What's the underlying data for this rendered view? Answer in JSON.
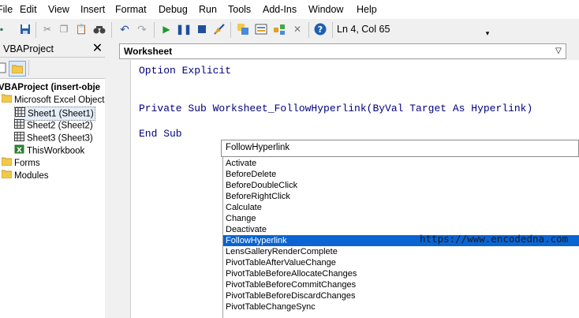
{
  "menu": [
    "File",
    "Edit",
    "View",
    "Insert",
    "Format",
    "Debug",
    "Run",
    "Tools",
    "Add-Ins",
    "Window",
    "Help"
  ],
  "status": {
    "position": "Ln 4, Col 65"
  },
  "toolbar_icons": [
    "excel-icon",
    "save-icon",
    "cut-icon",
    "copy-icon",
    "paste-icon",
    "find-icon",
    "undo-icon",
    "redo-icon",
    "run-icon",
    "break-icon",
    "reset-icon",
    "design-mode-icon",
    "project-explorer-icon",
    "properties-icon",
    "object-browser-icon",
    "toolbox-icon",
    "help-icon"
  ],
  "project": {
    "title": "VBAProject",
    "close_glyph": "✕",
    "root": "VBAProject (insert-obje",
    "excel_objects": "Microsoft Excel Objects",
    "sheets": [
      "Sheet1 (Sheet1)",
      "Sheet2 (Sheet2)",
      "Sheet3 (Sheet3)"
    ],
    "workbook": "ThisWorkbook",
    "forms": "Forms",
    "modules": "Modules"
  },
  "editor": {
    "object_combo": "Worksheet",
    "lines": [
      "Option Explicit",
      "Private Sub Worksheet_FollowHyperlink(ByVal Target As Hyperlink)",
      "End Sub"
    ]
  },
  "autocomplete": {
    "input": "FollowHyperlink",
    "items": [
      "Activate",
      "BeforeDelete",
      "BeforeDoubleClick",
      "BeforeRightClick",
      "Calculate",
      "Change",
      "Deactivate",
      "FollowHyperlink",
      "LensGalleryRenderComplete",
      "PivotTableAfterValueChange",
      "PivotTableBeforeAllocateChanges",
      "PivotTableBeforeCommitChanges",
      "PivotTableBeforeDiscardChanges",
      "PivotTableChangeSync"
    ],
    "selected": "FollowHyperlink"
  },
  "watermark": "https://www.encodedna.com",
  "colors": {
    "selection": "#0a64d2",
    "keyword": "#00007f",
    "toolbar_bg": "#f0f0f0"
  }
}
